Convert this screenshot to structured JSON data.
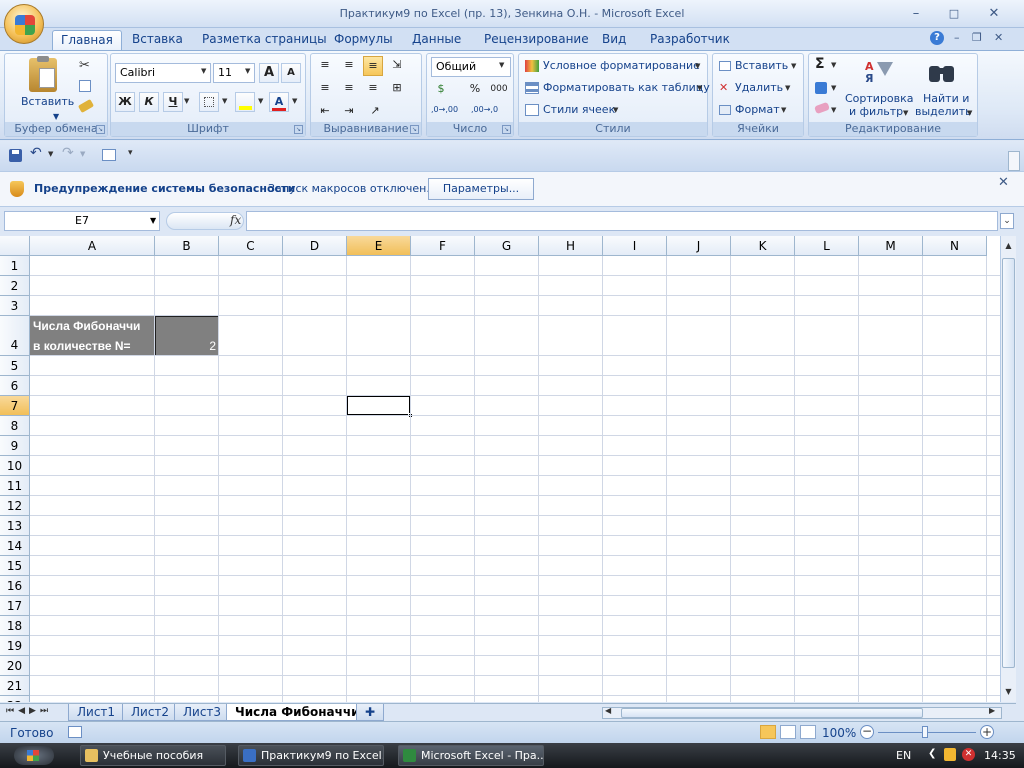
{
  "window": {
    "title": "Практикум9 по Excel (пр. 13), Зенкина О.Н. - Microsoft Excel",
    "minimize": "–",
    "maximize": "□",
    "close": "✕"
  },
  "ribbon_tabs": [
    "Главная",
    "Вставка",
    "Разметка страницы",
    "Формулы",
    "Данные",
    "Рецензирование",
    "Вид",
    "Разработчик"
  ],
  "groups": {
    "clipboard": {
      "label": "Буфер обмена",
      "paste": "Вставить"
    },
    "font": {
      "label": "Шрифт",
      "font_name": "Calibri",
      "font_size": "11",
      "grow": "A",
      "shrink": "A",
      "bold": "Ж",
      "italic": "К",
      "underline": "Ч",
      "font_color_letter": "A"
    },
    "alignment": {
      "label": "Выравнивание"
    },
    "number": {
      "label": "Число",
      "format": "Общий",
      "percent": "%",
      "thousands": "000",
      "inc_dec": ",0→,00",
      "dec_dec": ",00→,0"
    },
    "styles": {
      "label": "Стили",
      "conditional": "Условное форматирование",
      "as_table": "Форматировать как таблицу",
      "cell_styles": "Стили ячеек"
    },
    "cells": {
      "label": "Ячейки",
      "insert": "Вставить",
      "delete": "Удалить",
      "format": "Формат"
    },
    "editing": {
      "label": "Редактирование",
      "sigma": "Σ",
      "sort_line1": "Сортировка",
      "sort_line2": "и фильтр",
      "find_line1": "Найти и",
      "find_line2": "выделить"
    }
  },
  "security_bar": {
    "title": "Предупреждение системы безопасности",
    "message": "Запуск макросов отключен.",
    "button": "Параметры..."
  },
  "formula_bar": {
    "name_box": "E7",
    "fx": "fx",
    "formula": ""
  },
  "columns": [
    "A",
    "B",
    "C",
    "D",
    "E",
    "F",
    "G",
    "H",
    "I",
    "J",
    "K",
    "L",
    "M",
    "N"
  ],
  "rows": [
    "1",
    "2",
    "3",
    "4",
    "5",
    "6",
    "7",
    "8",
    "9",
    "10",
    "11",
    "12",
    "13",
    "14",
    "15",
    "16",
    "17",
    "18",
    "19",
    "20",
    "21",
    "22"
  ],
  "selected_column": "E",
  "selected_row": "7",
  "cells": {
    "a4_line1": "Числа Фибоначчи",
    "a4_line2": "в количестве N=",
    "b4": "2"
  },
  "sheets": [
    "Лист1",
    "Лист2",
    "Лист3",
    "Числа Фибоначчи"
  ],
  "active_sheet": "Числа Фибоначчи",
  "status": {
    "ready": "Готово",
    "zoom": "100%"
  },
  "taskbar": {
    "tasks": [
      "Учебные пособия",
      "Практикум9 по Excel...",
      "Microsoft Excel - Пра..."
    ],
    "lang": "EN",
    "clock": "14:35"
  },
  "colors": {
    "header_fill": "#808080",
    "selected_header": "#f4c46a",
    "accent": "#15428b"
  }
}
